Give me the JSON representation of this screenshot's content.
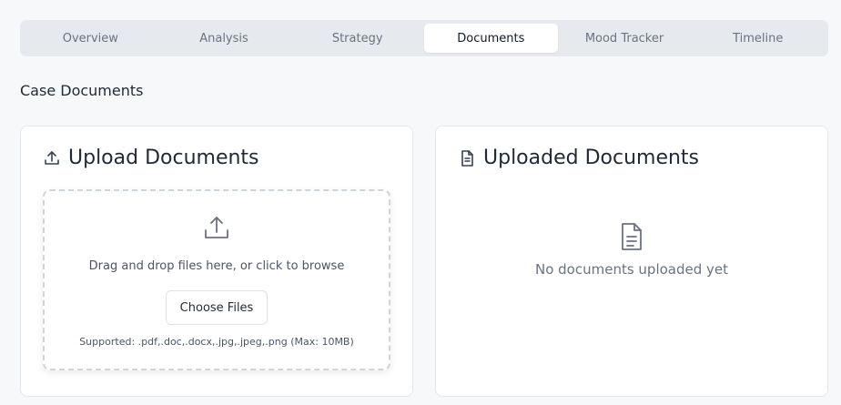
{
  "tabs": [
    {
      "label": "Overview",
      "active": false
    },
    {
      "label": "Analysis",
      "active": false
    },
    {
      "label": "Strategy",
      "active": false
    },
    {
      "label": "Documents",
      "active": true
    },
    {
      "label": "Mood Tracker",
      "active": false
    },
    {
      "label": "Timeline",
      "active": false
    }
  ],
  "section": {
    "title": "Case Documents"
  },
  "upload": {
    "title": "Upload Documents",
    "title_icon": "upload-icon",
    "dropzone_icon": "upload-icon",
    "dropzone_text": "Drag and drop files here, or click to browse",
    "button_label": "Choose Files",
    "supported_text": "Supported: .pdf,.doc,.docx,.jpg,.jpeg,.png (Max: 10MB)"
  },
  "uploaded": {
    "title": "Uploaded Documents",
    "title_icon": "document-icon",
    "empty_icon": "document-icon",
    "empty_text": "No documents uploaded yet"
  },
  "colors": {
    "page_bg": "#f7f8fa",
    "tab_bar_bg": "#e6eaee",
    "text_primary": "#1f2937",
    "text_muted": "#6b7280"
  }
}
